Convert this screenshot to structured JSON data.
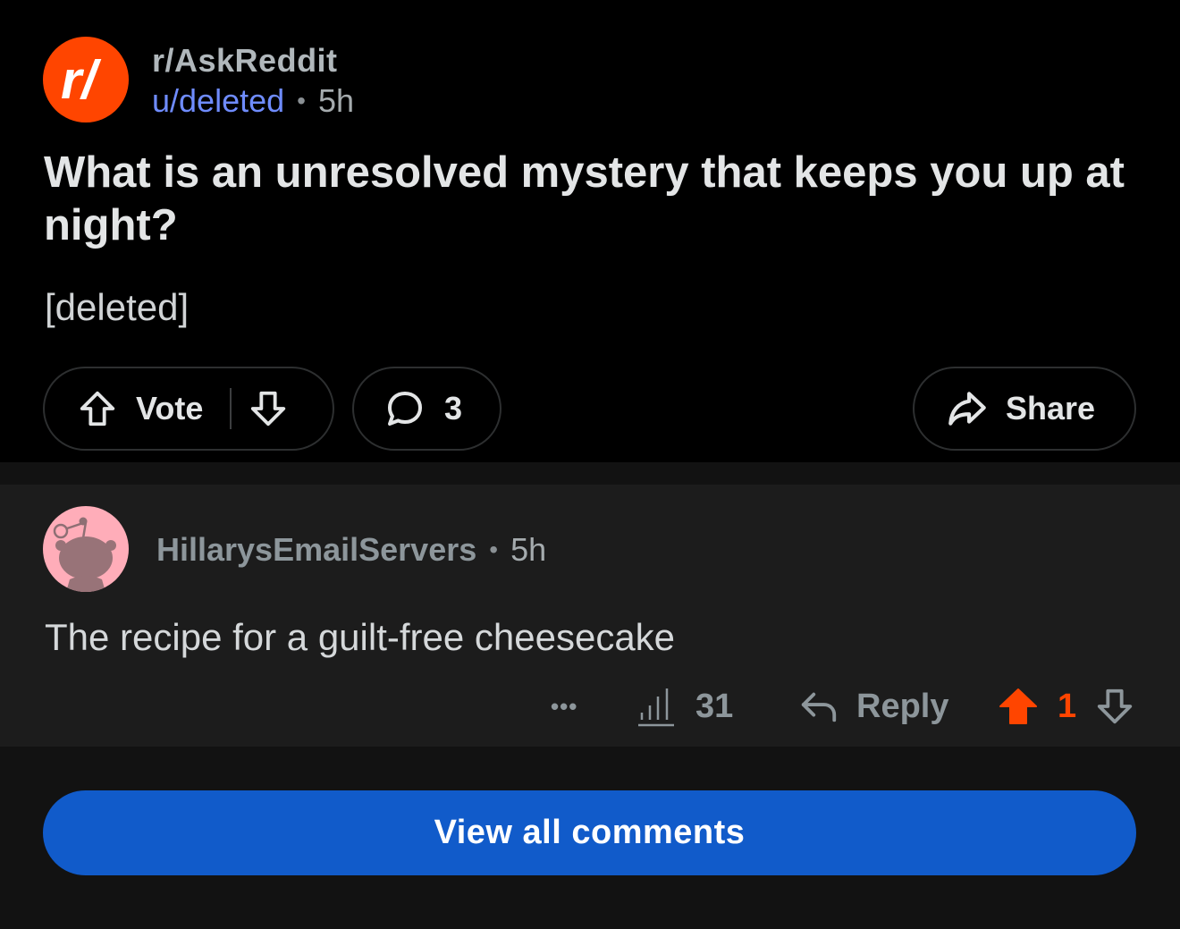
{
  "post": {
    "subreddit": "r/AskReddit",
    "author": "u/deleted",
    "separator": "•",
    "time": "5h",
    "title": "What is an unresolved mystery that keeps you up at night?",
    "body": "[deleted]",
    "vote_label": "Vote",
    "comment_count": "3",
    "share_label": "Share"
  },
  "comment": {
    "author": "HillarysEmailServers",
    "separator": "•",
    "time": "5h",
    "text": "The recipe for a guilt-free cheesecake",
    "more_label": "•••",
    "views": "31",
    "reply_label": "Reply",
    "score": "1"
  },
  "footer": {
    "view_all_label": "View all comments"
  },
  "colors": {
    "brand": "#ff4500",
    "link": "#6f8cff",
    "button": "#115bca",
    "upvoted": "#ff4500"
  },
  "icons": [
    "reddit-logo-icon",
    "upvote-icon",
    "downvote-icon",
    "comment-bubble-icon",
    "share-arrow-icon",
    "more-dots-icon",
    "stats-bars-icon",
    "reply-arrow-icon",
    "upvote-filled-icon"
  ]
}
